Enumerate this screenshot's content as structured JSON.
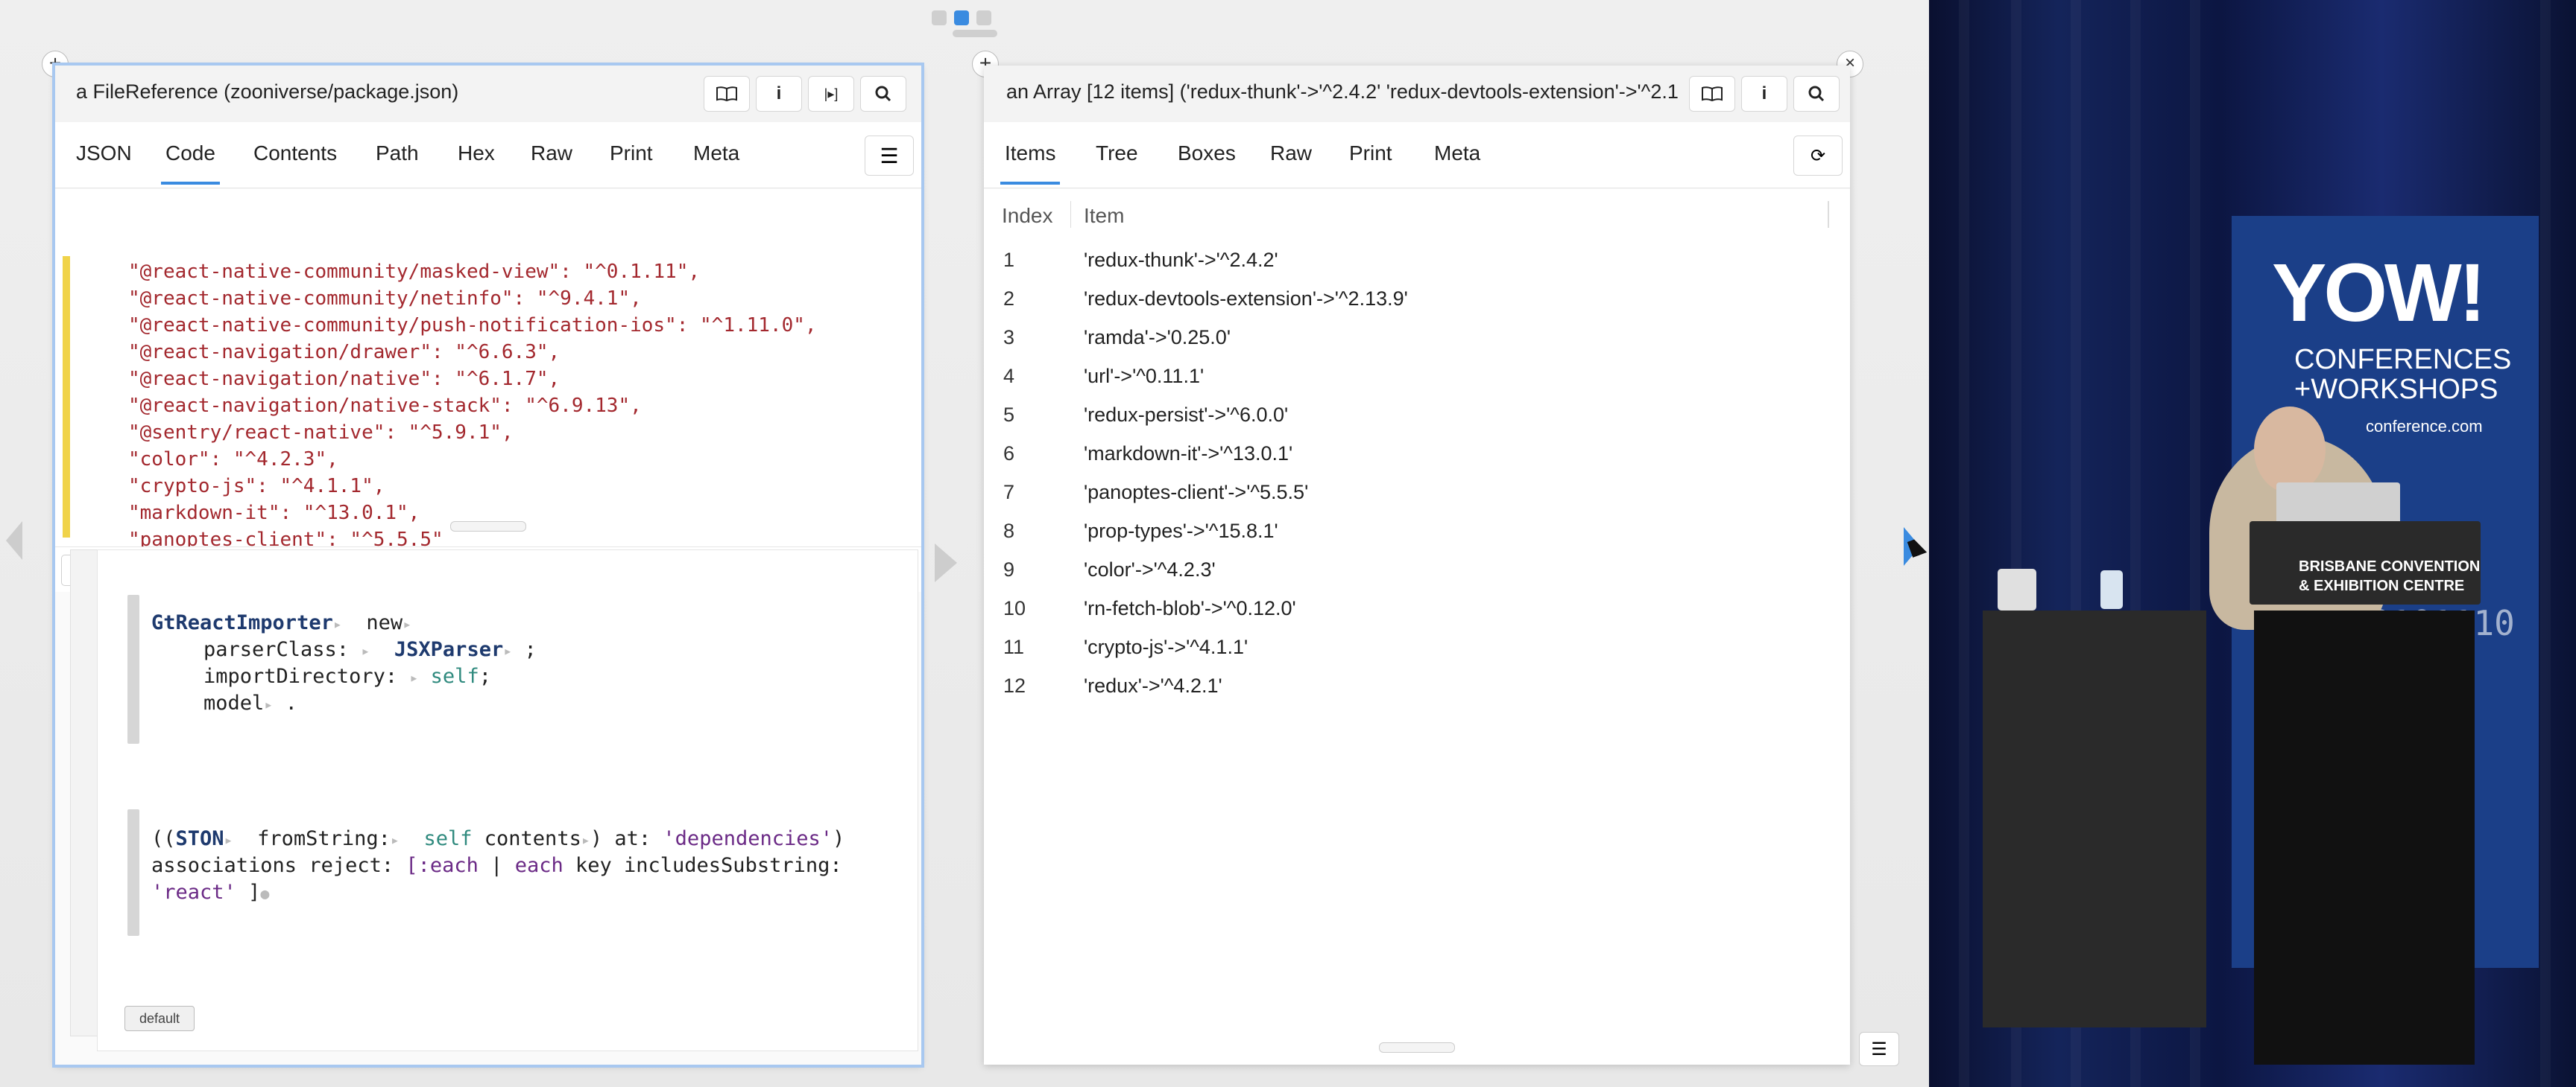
{
  "workspace": {
    "page_dots": 3,
    "active_dot": 1
  },
  "left_pane": {
    "title": "a FileReference (zooniverse/package.json)",
    "header_buttons": [
      "book-icon",
      "info-icon",
      "play-icon",
      "search-icon"
    ],
    "tabs": [
      "JSON",
      "Code",
      "Contents",
      "Path",
      "Hex",
      "Raw",
      "Print",
      "Meta"
    ],
    "active_tab": "Code",
    "code_lines": [
      "\"@react-native-community/masked-view\": \"^0.1.11\",",
      "\"@react-native-community/netinfo\": \"^9.4.1\",",
      "\"@react-native-community/push-notification-ios\": \"^1.11.0\",",
      "\"@react-navigation/drawer\": \"^6.6.3\",",
      "\"@react-navigation/native\": \"^6.1.7\",",
      "\"@react-navigation/native-stack\": \"^6.9.13\",",
      "\"@sentry/react-native\": \"^5.9.1\",",
      "\"color\": \"^4.2.3\",",
      "\"crypto-js\": \"^4.1.1\",",
      "\"markdown-it\": \"^13.0.1\",",
      "\"panoptes-client\": \"^5.5.5\""
    ],
    "accept_label": "✔",
    "cancel_label": "✖",
    "snippet1": {
      "l1_class": "GtReactImporter",
      "l1_msg": "new",
      "l2_kw": "parserClass:",
      "l2_class": "JSXParser",
      "l2_end": ";",
      "l3_kw": "importDirectory:",
      "l3_self": "self",
      "l3_end": ";",
      "l4_kw": "model",
      "l4_end": "."
    },
    "snippet2": {
      "open": "((",
      "class": "STON",
      "msg": "fromString:",
      "self": "self",
      "contents": "contents",
      "at": ") at:",
      "str": "'dependencies'",
      "close": ")",
      "l2": "associations reject: ",
      "blk": "[:each",
      "bar": " | ",
      "each": "each",
      "rest": " key includesSubstring:",
      "l3_str": "'react'",
      "l3_end": " ]"
    },
    "default_label": "default"
  },
  "right_pane": {
    "title": "an Array [12 items] ('redux-thunk'->'^2.4.2' 'redux-devtools-extension'->'^2.1",
    "header_buttons": [
      "book-icon",
      "info-icon",
      "search-icon"
    ],
    "tabs": [
      "Items",
      "Tree",
      "Boxes",
      "Raw",
      "Print",
      "Meta"
    ],
    "active_tab": "Items",
    "columns": [
      "Index",
      "Item"
    ],
    "rows": [
      {
        "index": "1",
        "item": "'redux-thunk'->'^2.4.2'"
      },
      {
        "index": "2",
        "item": "'redux-devtools-extension'->'^2.13.9'"
      },
      {
        "index": "3",
        "item": "'ramda'->'0.25.0'"
      },
      {
        "index": "4",
        "item": "'url'->'^0.11.1'"
      },
      {
        "index": "5",
        "item": "'redux-persist'->'^6.0.0'"
      },
      {
        "index": "6",
        "item": "'markdown-it'->'^13.0.1'"
      },
      {
        "index": "7",
        "item": "'panoptes-client'->'^5.5.5'"
      },
      {
        "index": "8",
        "item": "'prop-types'->'^15.8.1'"
      },
      {
        "index": "9",
        "item": "'color'->'^4.2.3'"
      },
      {
        "index": "10",
        "item": "'rn-fetch-blob'->'^0.12.0'"
      },
      {
        "index": "11",
        "item": "'crypto-js'->'^4.1.1'"
      },
      {
        "index": "12",
        "item": "'redux'->'^4.2.1'"
      }
    ]
  },
  "stage": {
    "banner_line1": "YOW!",
    "banner_line2": "CONFERENCES",
    "banner_line3": "+WORKSHOPS",
    "banner_url": "conference.com",
    "lectern_line1": "BRISBANE CONVENTION",
    "lectern_line2": "& EXHIBITION CENTRE",
    "binary_text": "0101110"
  },
  "colors": {
    "accent": "#3a8be0",
    "code_string": "#a3282e",
    "change_marker": "#f0d34a",
    "banner_blue": "#1b3f88"
  }
}
